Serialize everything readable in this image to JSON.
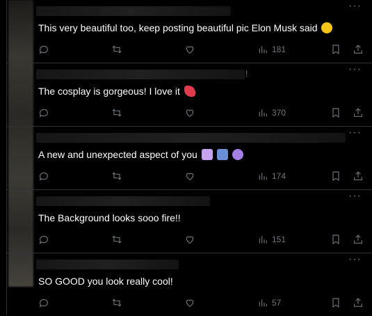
{
  "replies": [
    {
      "text": "This very beautiful too, keep posting beautiful pic Elon Musk said",
      "emoji": "heart-eyes",
      "emoji_color": "#f5c518",
      "views": "181",
      "mark": ""
    },
    {
      "text": "The cosplay is gorgeous! I love it",
      "emoji": "heart-ribbon",
      "emoji_color": "#e23b4e",
      "views": "370",
      "mark": "!"
    },
    {
      "text": "A new and unexpected aspect of you",
      "emoji": "purple-emojis",
      "emoji_color": "#a57fe5",
      "views": "174",
      "mark": ""
    },
    {
      "text": "The Background looks sooo fire!!",
      "emoji": "",
      "emoji_color": "",
      "views": "151",
      "mark": ""
    },
    {
      "text": "SO GOOD you look really cool!",
      "emoji": "",
      "emoji_color": "",
      "views": "57",
      "mark": ""
    }
  ],
  "icons": {
    "more": "more-horizontal-icon",
    "reply": "comment-icon",
    "repost": "repost-icon",
    "like": "heart-icon",
    "views": "analytics-icon",
    "bookmark": "bookmark-icon",
    "share": "share-icon"
  },
  "colors": {
    "background": "#000000",
    "text": "#ffffff",
    "muted": "#71767b",
    "divider": "#2f3336"
  }
}
